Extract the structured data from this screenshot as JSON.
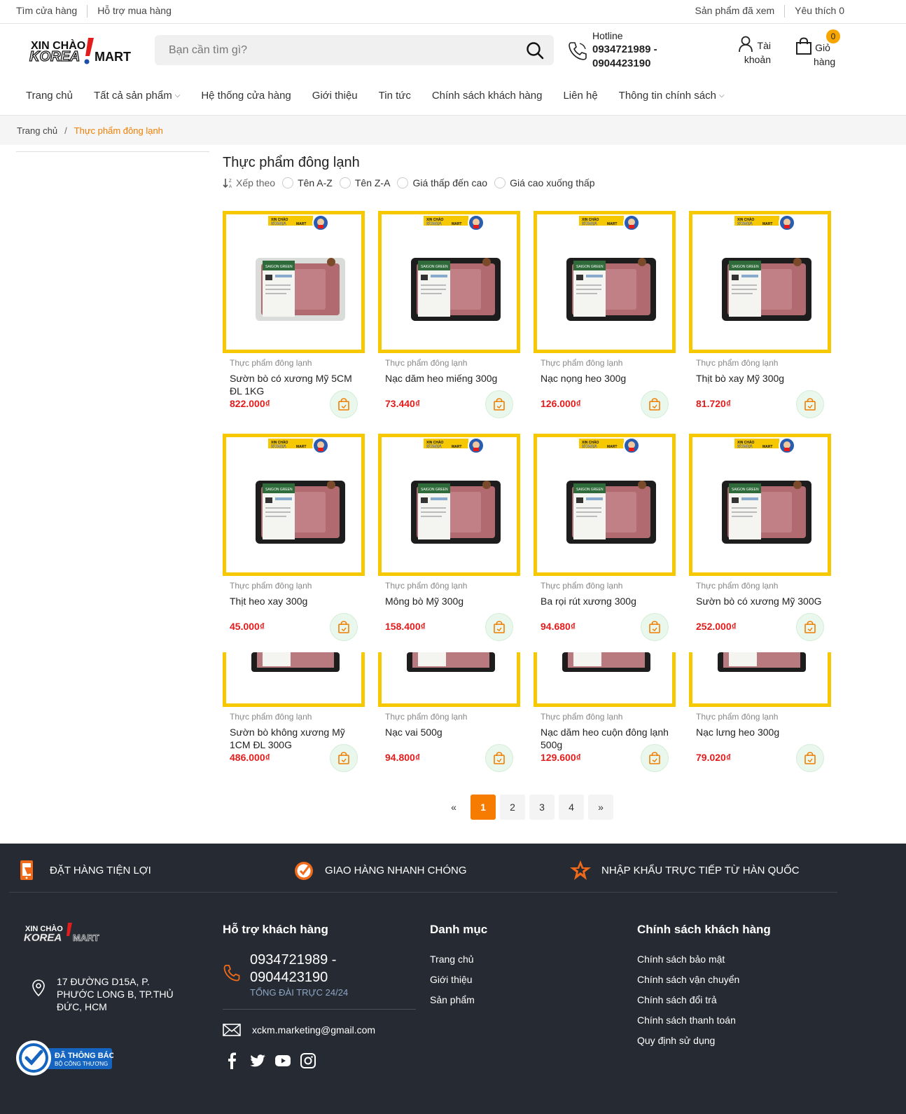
{
  "topbar": {
    "store_link": "Tìm cửa hàng",
    "support_link": "Hỗ trợ mua hàng",
    "viewed_link": "Sản phẩm đã xem",
    "wishlist_link": "Yêu thích 0"
  },
  "header": {
    "logo_text_top": "XIN CHÀO",
    "logo_text_main": "KOREA",
    "logo_text_mart": "MART",
    "search_placeholder": "Bạn cần tìm gì?",
    "hotline_label": "Hotline",
    "hotline_number": "0934721989 - 0904423190",
    "account_label": "Tài khoản",
    "cart_label": "Giỏ hàng",
    "cart_count": "0"
  },
  "nav": {
    "items": [
      {
        "label": "Trang chủ"
      },
      {
        "label": "Tất cả sản phẩm"
      },
      {
        "label": "Hệ thống cửa hàng"
      },
      {
        "label": "Giới thiệu"
      },
      {
        "label": "Tin tức"
      },
      {
        "label": "Chính sách khách hàng"
      },
      {
        "label": "Liên hệ"
      },
      {
        "label": "Thông tin chính sách"
      }
    ]
  },
  "breadcrumb": {
    "home": "Trang chủ",
    "separator": "/",
    "current": "Thực phẩm đông lạnh"
  },
  "page": {
    "title": "Thực phẩm đông lạnh",
    "sort_label": "Xếp theo",
    "sort_options": [
      "Tên A-Z",
      "Tên Z-A",
      "Giá thấp đến cao",
      "Giá cao xuống thấp"
    ]
  },
  "products": [
    {
      "category": "Thực phẩm đông lạnh",
      "name": "Sườn bò có xương Mỹ 5CM ĐL 1KG",
      "price": "822.000₫"
    },
    {
      "category": "Thực phẩm đông lạnh",
      "name": "Nạc dăm heo miếng 300g",
      "price": "73.440₫"
    },
    {
      "category": "Thực phẩm đông lạnh",
      "name": "Nạc nọng heo 300g",
      "price": "126.000₫"
    },
    {
      "category": "Thực phẩm đông lạnh",
      "name": "Thịt bò xay Mỹ 300g",
      "price": "81.720₫"
    },
    {
      "category": "Thực phẩm đông lạnh",
      "name": "Thịt heo xay 300g",
      "price": "45.000₫"
    },
    {
      "category": "Thực phẩm đông lạnh",
      "name": "Mông bò Mỹ 300g",
      "price": "158.400₫"
    },
    {
      "category": "Thực phẩm đông lạnh",
      "name": "Ba rọi rút xương 300g",
      "price": "94.680₫"
    },
    {
      "category": "Thực phẩm đông lạnh",
      "name": "Sườn bò có xương Mỹ 300G",
      "price": "252.000₫"
    },
    {
      "category": "Thực phẩm đông lạnh",
      "name": "Sườn bò không xương Mỹ 1CM ĐL 300G",
      "price": "486.000₫"
    },
    {
      "category": "Thực phẩm đông lạnh",
      "name": "Nạc vai 500g",
      "price": "94.800₫"
    },
    {
      "category": "Thực phẩm đông lạnh",
      "name": "Nạc dăm heo cuộn đông lạnh 500g",
      "price": "129.600₫"
    },
    {
      "category": "Thực phẩm đông lạnh",
      "name": "Nạc lưng heo 300g",
      "price": "79.020₫"
    }
  ],
  "pagination": {
    "prev": "«",
    "pages": [
      "1",
      "2",
      "3",
      "4"
    ],
    "current": "1",
    "next": "»"
  },
  "footer": {
    "features": [
      {
        "label": "ĐẶT HÀNG TIỆN LỢI",
        "icon": "phone-order-icon"
      },
      {
        "label": "GIAO HÀNG NHANH CHÓNG",
        "icon": "fast-delivery-icon"
      },
      {
        "label": "NHẬP KHẨU TRỰC TIẾP TỪ HÀN QUỐC",
        "icon": "star-import-icon"
      }
    ],
    "address": "17 ĐƯỜNG D15A, P. PHƯỚC LONG B, TP.THỦ ĐỨC, HCM",
    "support_title": "Hỗ trợ khách hàng",
    "phone": "0934721989 - 0904423190",
    "phone_sub": "TỔNG ĐÀI TRỰC 24/24",
    "email": "xckm.marketing@gmail.com",
    "category_title": "Danh mục",
    "category_links": [
      "Trang chủ",
      "Giới thiệu",
      "Sản phẩm"
    ],
    "policy_title": "Chính sách khách hàng",
    "policy_links": [
      "Chính sách bảo mật",
      "Chính sách vận chuyển",
      "Chính sách đổi trả",
      "Chính sách thanh toán",
      "Quy định sử dụng"
    ],
    "badge_line1": "ĐÃ THÔNG BÁO",
    "badge_line2": "BỘ CÔNG THƯƠNG"
  },
  "colors": {
    "accent": "#f57c00",
    "price": "#e31c1c",
    "frame": "#f5c800",
    "footer_bg": "#262b33"
  }
}
